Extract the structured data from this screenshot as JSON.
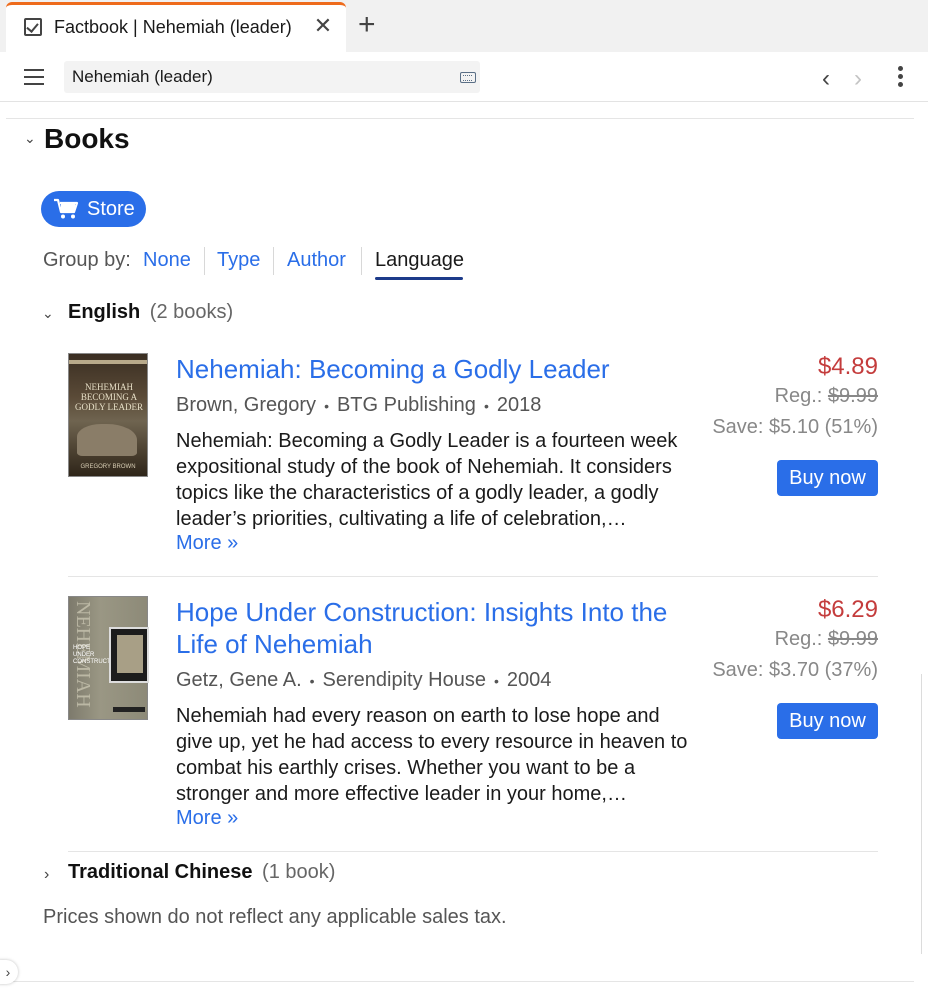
{
  "tab": {
    "title": "Factbook | Nehemiah (leader)",
    "close_glyph": "✕",
    "new_tab_glyph": "+"
  },
  "address": {
    "value": "Nehemiah (leader)"
  },
  "nav": {
    "back_glyph": "‹",
    "forward_glyph": "›"
  },
  "section": {
    "title": "Books",
    "chevron": "⌄"
  },
  "store": {
    "label": "Store"
  },
  "group_by": {
    "label": "Group by:",
    "options": [
      "None",
      "Type",
      "Author",
      "Language"
    ],
    "selected": "Language"
  },
  "groups": [
    {
      "name": "English",
      "count": "(2 books)",
      "expanded": true
    },
    {
      "name": "Traditional Chinese",
      "count": "(1 book)",
      "expanded": false
    }
  ],
  "books": [
    {
      "title": "Nehemiah: Becoming a Godly Leader",
      "author": "Brown, Gregory",
      "publisher": "BTG Publishing",
      "year": "2018",
      "description": "Nehemiah: Becoming a Godly Leader is a fourteen week expositional study of the book of Nehemiah. It considers topics like the characteristics of a godly leader, a godly leader’s priorities, cultivating a life of celebration,…",
      "more": "More »",
      "price": "$4.89",
      "reg_label": "Reg.:",
      "reg_price": "$9.99",
      "save": "Save: $5.10 (51%)",
      "buy": "Buy now",
      "cover_text": "NEHEMIAH BECOMING A GODLY LEADER",
      "cover_author": "GREGORY BROWN"
    },
    {
      "title": "Hope Under Construction: Insights Into the Life of Nehemiah",
      "author": "Getz, Gene A.",
      "publisher": "Serendipity House",
      "year": "2004",
      "description": "Nehemiah had every reason on earth to lose hope and give up, yet he had access to every resource in heaven to combat his earthly crises. Whether you want to be a stronger and more effective leader in your home,…",
      "more": "More »",
      "price": "$6.29",
      "reg_label": "Reg.:",
      "reg_price": "$9.99",
      "save": "Save: $3.70 (37%)",
      "buy": "Buy now",
      "cover_text": "HOPE UNDER CONSTRUCTION",
      "cover_vertical": "NEHEMIAH"
    }
  ],
  "footnote": "Prices shown do not reflect any applicable sales tax.",
  "colors": {
    "accent": "#2a6ee8",
    "price_red": "#c43c3c",
    "tab_accent": "#ee6b1c",
    "underline": "#1d3b8a"
  }
}
